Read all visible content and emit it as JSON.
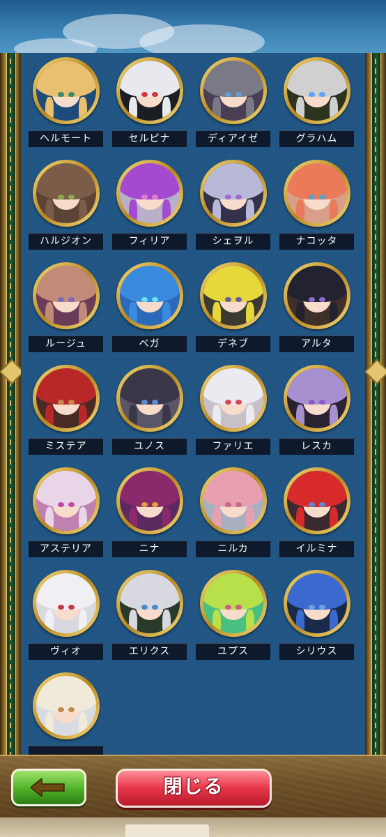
{
  "characters": [
    {
      "name": "ヘルモート",
      "hair": "#e8c070",
      "eye": "#3a8a6a",
      "bg": "#1d4c7a"
    },
    {
      "name": "セルピナ",
      "hair": "#e7e9ef",
      "eye": "#d23a3a",
      "bg": "#1a1d24"
    },
    {
      "name": "ディアイゼ",
      "hair": "#7a7a86",
      "eye": "#6a9ad6",
      "bg": "#4a3e55"
    },
    {
      "name": "グラハム",
      "hair": "#d0d0d0",
      "eye": "#5aa0ff",
      "bg": "#2c3420"
    },
    {
      "name": "ハルジオン",
      "hair": "#7a5c48",
      "eye": "#8aa84a",
      "bg": "#5c4434"
    },
    {
      "name": "フィリア",
      "hair": "#a44ad0",
      "eye": "#e07ad0",
      "bg": "#b8b0c8"
    },
    {
      "name": "シェヲル",
      "hair": "#b8b8d8",
      "eye": "#a06ad0",
      "bg": "#34324a"
    },
    {
      "name": "ナコッタ",
      "hair": "#ea7a5a",
      "eye": "#5aa0c8",
      "bg": "#d8a088"
    },
    {
      "name": "ルージュ",
      "hair": "#c28a78",
      "eye": "#7a6ab8",
      "bg": "#6a3c5a"
    },
    {
      "name": "ベガ",
      "hair": "#3a8ae0",
      "eye": "#6ae0f0",
      "bg": "#2a6ab8"
    },
    {
      "name": "デネブ",
      "hair": "#e6d83a",
      "eye": "#6a5aa0",
      "bg": "#3a3a30"
    },
    {
      "name": "アルタ",
      "hair": "#222230",
      "eye": "#8a6ad0",
      "bg": "#40302a"
    },
    {
      "name": "ミステア",
      "hair": "#b82828",
      "eye": "#c88a4a",
      "bg": "#4a2a24"
    },
    {
      "name": "ユノス",
      "hair": "#3a3848",
      "eye": "#5a8ad0",
      "bg": "#5a5668"
    },
    {
      "name": "ファリエ",
      "hair": "#eaeaf0",
      "eye": "#d04a5a",
      "bg": "#c8c0c8"
    },
    {
      "name": "レスカ",
      "hair": "#a890d0",
      "eye": "#8a5ac8",
      "bg": "#2a2230"
    },
    {
      "name": "アステリア",
      "hair": "#e8d6e8",
      "eye": "#c04aa0",
      "bg": "#c080b0"
    },
    {
      "name": "ニナ",
      "hair": "#8a2a6a",
      "eye": "#e0a040",
      "bg": "#5a2a60"
    },
    {
      "name": "ニルカ",
      "hair": "#e8a0b0",
      "eye": "#c86a8a",
      "bg": "#a8b0c0"
    },
    {
      "name": "イルミナ",
      "hair": "#d82a2a",
      "eye": "#5a8ad0",
      "bg": "#3a2a30"
    },
    {
      "name": "ヴィオ",
      "hair": "#f0f0f4",
      "eye": "#c03a4a",
      "bg": "#d8d8e0"
    },
    {
      "name": "エリクス",
      "hair": "#d8d8e0",
      "eye": "#4a8ac8",
      "bg": "#2a3a2a"
    },
    {
      "name": "ユプス",
      "hair": "#b8e04a",
      "eye": "#d05a8a",
      "bg": "#4ac080"
    },
    {
      "name": "シリウス",
      "hair": "#3a6ad0",
      "eye": "#6aa0e0",
      "bg": "#1a2a4a"
    },
    {
      "name": "",
      "hair": "#f0ead8",
      "eye": "#c08a4a",
      "bg": "#d8dce0"
    }
  ],
  "buttons": {
    "back": "",
    "close": "閉じる"
  },
  "colors": {
    "panel": "#215583",
    "frame_gold": "#e2c56d",
    "back_green": "#4fb128",
    "close_red": "#e8374a"
  },
  "icons": {
    "back": "left-arrow-icon"
  }
}
